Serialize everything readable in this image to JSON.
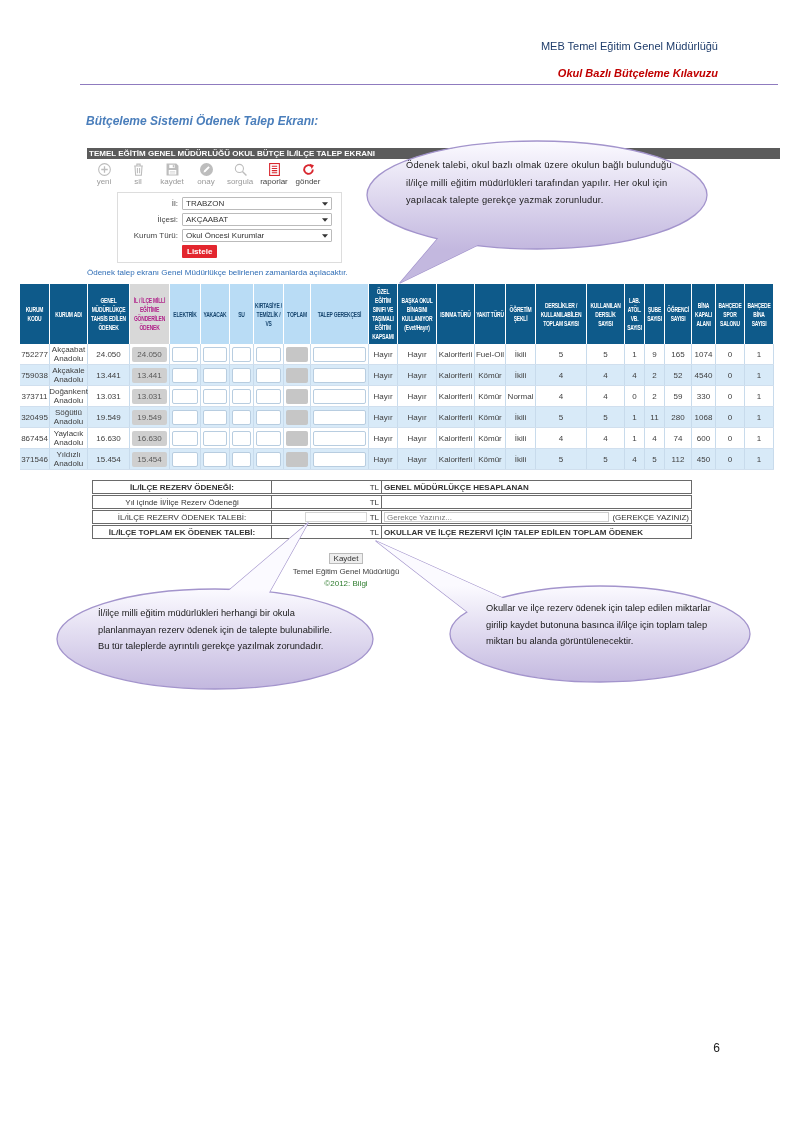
{
  "header": {
    "organization": "MEB Temel Eğitim Genel Müdürlüğü",
    "document": "Okul Bazlı Bütçeleme Kılavuzu"
  },
  "section_title": "Bütçeleme Sistemi  Ödenek Talep Ekranı:",
  "app": {
    "title": "TEMEL EĞİTİM GENEL MÜDÜRLÜĞÜ OKUL BÜTÇE İL/İLÇE TALEP EKRANI",
    "toolbar": [
      {
        "label": "yeni",
        "disabled": true
      },
      {
        "label": "sil",
        "disabled": true
      },
      {
        "label": "kaydet",
        "disabled": true
      },
      {
        "label": "onay",
        "disabled": true
      },
      {
        "label": "sorgula",
        "disabled": true
      },
      {
        "label": "raporlar",
        "disabled": false
      },
      {
        "label": "gönder",
        "disabled": false
      }
    ],
    "filters": [
      {
        "label": "İl:",
        "value": "TRABZON"
      },
      {
        "label": "İlçesi:",
        "value": "AKÇAABAT"
      },
      {
        "label": "Kurum Türü:",
        "value": "Okul Öncesi Kurumlar"
      }
    ],
    "list_button": "Listele",
    "notice": "Ödenek talep ekranı Genel Müdürlükçe belirlenen zamanlarda açılacaktır.",
    "table": {
      "columns": [
        {
          "label": "KURUM KODU",
          "kind": "data"
        },
        {
          "label": "KURUM ADI",
          "kind": "data"
        },
        {
          "label": "GENEL MÜDÜRLÜKÇE TAHSİS EDİLEN ÖDENEK",
          "kind": "data"
        },
        {
          "label": "İL / İLÇE MİLLİ EĞİTİME GÖNDERİLEN ÖDENEK",
          "kind": "sent"
        },
        {
          "label": "ELEKTRİK",
          "kind": "input"
        },
        {
          "label": "YAKACAK",
          "kind": "input"
        },
        {
          "label": "SU",
          "kind": "input"
        },
        {
          "label": "KIRTASİYE / TEMİZLİK / VS",
          "kind": "input"
        },
        {
          "label": "TOPLAM",
          "kind": "total"
        },
        {
          "label": "TALEP GEREKÇESİ",
          "kind": "input"
        },
        {
          "label": "ÖZEL EĞİTİM SINIFI VE TAŞIMALI EĞİTİM KAPSAMI",
          "kind": "data"
        },
        {
          "label": "BAŞKA OKUL BİNASINI KULLANIYOR (Evet/Hayır)",
          "kind": "data"
        },
        {
          "label": "ISINMA TÜRÜ",
          "kind": "data"
        },
        {
          "label": "YAKIT TÜRÜ",
          "kind": "data"
        },
        {
          "label": "ÖĞRETİM ŞEKLİ",
          "kind": "data"
        },
        {
          "label": "DERSLİKLER / KULLANILABİLEN TOPLAM SAYISI",
          "kind": "data"
        },
        {
          "label": "KULLANILAN DERSLİK SAYISI",
          "kind": "data"
        },
        {
          "label": "LAB. ATÖL. VB. SAYISI",
          "kind": "data"
        },
        {
          "label": "ŞUBE SAYISI",
          "kind": "data"
        },
        {
          "label": "ÖĞRENCİ SAYISI",
          "kind": "data"
        },
        {
          "label": "BİNA KAPALI ALANI",
          "kind": "data"
        },
        {
          "label": "BAHÇEDE SPOR SALONU",
          "kind": "data"
        },
        {
          "label": "BAHÇEDE BİNA SAYISI",
          "kind": "data"
        }
      ],
      "rows": [
        {
          "cells": [
            "752277",
            "Akçaabat Anadolu",
            "24.050",
            "24.050",
            "",
            "",
            "",
            "",
            "",
            "",
            "Hayır",
            "Hayır",
            "Kaloriferli",
            "Fuel-Oil",
            "İkili",
            "5",
            "5",
            "1",
            "9",
            "165",
            "1074",
            "0",
            "1"
          ]
        },
        {
          "cells": [
            "759038",
            "Akçakale Anadolu",
            "13.441",
            "13.441",
            "",
            "",
            "",
            "",
            "",
            "",
            "Hayır",
            "Hayır",
            "Kaloriferli",
            "Kömür",
            "İkili",
            "4",
            "4",
            "4",
            "2",
            "52",
            "4540",
            "0",
            "1"
          ]
        },
        {
          "cells": [
            "373711",
            "Doğankent Anadolu",
            "13.031",
            "13.031",
            "",
            "",
            "",
            "",
            "",
            "",
            "Hayır",
            "Hayır",
            "Kaloriferli",
            "Kömür",
            "Normal",
            "4",
            "4",
            "0",
            "2",
            "59",
            "330",
            "0",
            "1"
          ]
        },
        {
          "cells": [
            "320495",
            "Söğütlü Anadolu",
            "19.549",
            "19.549",
            "",
            "",
            "",
            "",
            "",
            "",
            "Hayır",
            "Hayır",
            "Kaloriferli",
            "Kömür",
            "İkili",
            "5",
            "5",
            "1",
            "11",
            "280",
            "1068",
            "0",
            "1"
          ]
        },
        {
          "cells": [
            "867454",
            "Yaylacık Anadolu",
            "16.630",
            "16.630",
            "",
            "",
            "",
            "",
            "",
            "",
            "Hayır",
            "Hayır",
            "Kaloriferli",
            "Kömür",
            "İkili",
            "4",
            "4",
            "1",
            "4",
            "74",
            "600",
            "0",
            "1"
          ]
        },
        {
          "cells": [
            "371546",
            "Yıldızlı Anadolu",
            "15.454",
            "15.454",
            "",
            "",
            "",
            "",
            "",
            "",
            "Hayır",
            "Hayır",
            "Kaloriferli",
            "Kömür",
            "İkili",
            "5",
            "5",
            "4",
            "5",
            "112",
            "450",
            "0",
            "1"
          ]
        }
      ]
    },
    "reserve_table": {
      "rows": [
        {
          "kind": "summary",
          "label": "İL/İLÇE REZERV ÖDENEĞİ:",
          "unit": "TL",
          "note": "GENEL MÜDÜRLÜKÇE HESAPLANAN"
        },
        {
          "kind": "plain",
          "label": "Yıl içinde İl/İlçe Rezerv Ödeneği",
          "unit": "TL"
        },
        {
          "kind": "input",
          "label": "İL/İLÇE REZERV ÖDENEK TALEBİ:",
          "unit": "TL",
          "placeholder": "Gerekçe Yazınız...",
          "hint": "(GEREKÇE YAZINIZ)"
        },
        {
          "kind": "summary",
          "label": "İL/İLÇE TOPLAM EK ÖDENEK TALEBİ:",
          "unit": "TL",
          "note": "OKULLAR VE İLÇE REZERVİ İÇİN TALEP EDİLEN TOPLAM ÖDENEK"
        }
      ]
    },
    "save_button": "Kaydet",
    "footer": "Temel Eğitim Genel Müdürlüğü",
    "copyright": "©2012: Bilgi"
  },
  "callouts": [
    {
      "text": "Ödenek talebi, okul bazlı olmak üzere  okulun bağlı bulunduğu il/ilçe milli eğitim müdürlükleri tarafından yapılır. Her okul için yapılacak talepte gerekçe yazmak zorunludur."
    },
    {
      "text": "İl/ilçe milli eğitim müdürlükleri herhangi bir okula planlanmayan rezerv ödenek için de talepte bulunabilirle. Bu tür taleplerde ayrıntılı gerekçe yazılmak zorundadır."
    },
    {
      "text": "Okullar ve ilçe rezerv ödenek için talep edilen miktarlar girilip kaydet butonuna basınca il/ilçe için  toplam talep miktarı bu alanda görüntülenecektir."
    }
  ],
  "page_number": "6"
}
